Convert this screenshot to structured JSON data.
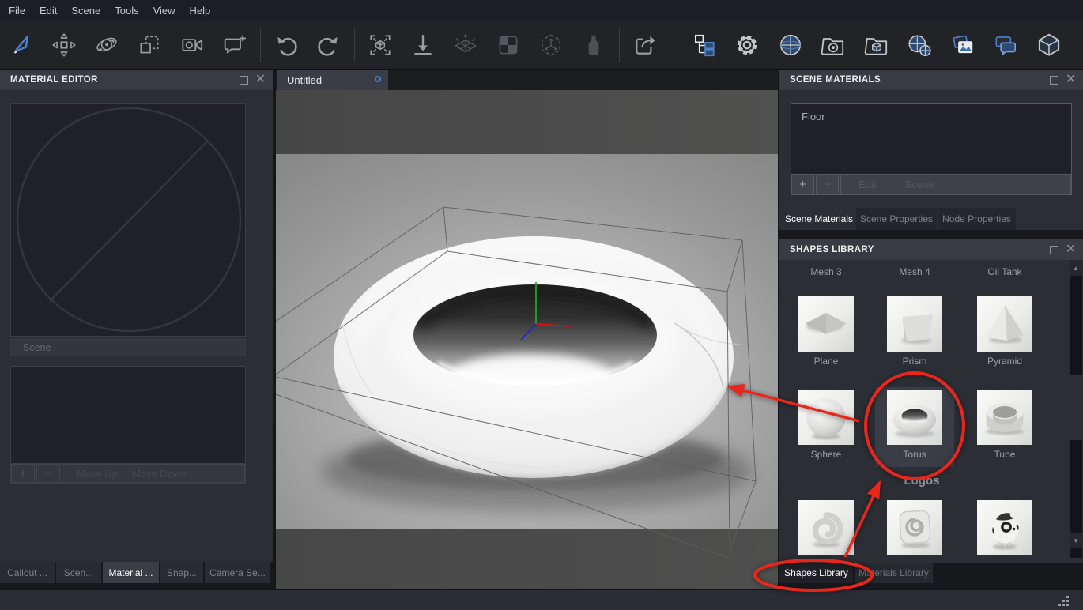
{
  "menu": {
    "items": [
      "File",
      "Edit",
      "Scene",
      "Tools",
      "View",
      "Help"
    ]
  },
  "toolbar": {
    "left_groups": [
      [
        {
          "icon": "select-arrow-icon",
          "style": "blue"
        },
        {
          "icon": "move-tool-icon",
          "style": "normal"
        },
        {
          "icon": "orbit-tool-icon",
          "style": "normal"
        },
        {
          "icon": "duplicate-icon",
          "style": "normal"
        },
        {
          "icon": "render-camera-icon",
          "style": "normal"
        },
        {
          "icon": "add-callout-icon",
          "style": "normal"
        }
      ],
      [
        {
          "icon": "undo-icon",
          "style": "normal"
        },
        {
          "icon": "redo-icon",
          "style": "normal"
        }
      ],
      [
        {
          "icon": "zoom-extents-icon",
          "style": "normal"
        },
        {
          "icon": "drop-to-ground-icon",
          "style": "normal"
        },
        {
          "icon": "explode-icon",
          "style": "dim"
        },
        {
          "icon": "checker-icon",
          "style": "dim"
        },
        {
          "icon": "hex-axes-icon",
          "style": "dim"
        },
        {
          "icon": "bottle-icon",
          "style": "dim"
        }
      ],
      [
        {
          "icon": "share-export-icon",
          "style": "normal"
        }
      ]
    ],
    "right_icons": [
      {
        "icon": "scene-tree-icon",
        "style": "blue"
      },
      {
        "icon": "settings-gear-icon",
        "style": "bright"
      },
      {
        "icon": "material-sphere-icon",
        "style": "blue"
      },
      {
        "icon": "folder-target-icon",
        "style": "normal"
      },
      {
        "icon": "folder-cube-icon",
        "style": "normal"
      },
      {
        "icon": "spheres-pair-icon",
        "style": "blue"
      },
      {
        "icon": "photos-icon",
        "style": "blue"
      },
      {
        "icon": "chat-bubbles-icon",
        "style": "blue"
      },
      {
        "icon": "cube-icon",
        "style": "bright"
      }
    ]
  },
  "material_editor": {
    "title": "MATERIAL EDITOR",
    "scene_field_placeholder": "Scene",
    "buttons": {
      "add": "+",
      "remove": "−",
      "move_up": "Move Up",
      "move_down": "Move Down"
    },
    "bottom_tabs": [
      "Callout ...",
      "Scen...",
      "Material ...",
      "Snap...",
      "Camera Se..."
    ],
    "active_tab_index": 2
  },
  "document": {
    "tab_title": "Untitled"
  },
  "scene_materials": {
    "title": "SCENE MATERIALS",
    "items": [
      "Floor"
    ],
    "buttons": {
      "add": "+",
      "remove": "−",
      "edit": "Edit",
      "scene": "Scene"
    },
    "tabs": [
      "Scene Materials",
      "Scene Properties",
      "Node Properties"
    ],
    "active_tab_index": 0
  },
  "shapes_library": {
    "title": "SHAPES LIBRARY",
    "scrolled_row_labels": [
      "Mesh 3",
      "Mesh 4",
      "Oil Tank"
    ],
    "rows": [
      {
        "items": [
          {
            "label": "Plane",
            "shape": "plane"
          },
          {
            "label": "Prism",
            "shape": "prism"
          },
          {
            "label": "Pyramid",
            "shape": "pyramid"
          }
        ]
      },
      {
        "items": [
          {
            "label": "Sphere",
            "shape": "sphere"
          },
          {
            "label": "Torus",
            "shape": "torus",
            "highlighted": true
          },
          {
            "label": "Tube",
            "shape": "tube"
          }
        ]
      }
    ],
    "section_header": "Logos",
    "logos_row": [
      {
        "label": "",
        "shape": "logo-swirl"
      },
      {
        "label": "",
        "shape": "logo-tile"
      },
      {
        "label": "",
        "shape": "logo-robot"
      }
    ],
    "bottom_tabs": [
      "Shapes Library",
      "Materials Library"
    ],
    "active_tab_index": 0
  },
  "annotations": {
    "color": "#e8281e",
    "targets": [
      "torus-library-item",
      "shapes-library-tab",
      "viewport-torus"
    ]
  },
  "theme": {
    "panel_bg": "#2b2e35",
    "titlebar_bg": "#383b42",
    "inset_bg": "#1f2127",
    "accent_blue": "#3f7fd6",
    "annotation_red": "#e8281e"
  }
}
